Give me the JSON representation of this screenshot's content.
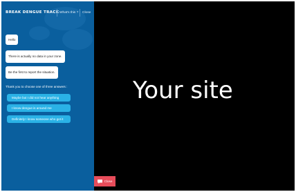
{
  "header": {
    "brand": "BREAK DENGUE TRACK",
    "whats_this": "What's this ?",
    "close": "Close"
  },
  "chat": {
    "messages": [
      "Hello",
      "There is actually no data in your zone.",
      "Be the first to report the situation."
    ],
    "prompt": "Thank you to choose one of three answers :",
    "answers": [
      "Maybe but I did not hear anything",
      "I know dengue is around me",
      "Definitely I know someone who got it"
    ]
  },
  "site": {
    "text": "Your site"
  },
  "toggle": {
    "label": "Close",
    "icon": "chat-icon"
  },
  "colors": {
    "panel": "#0a5f9e",
    "answer_button": "#2ab2e6",
    "close_tab": "#e74c5a",
    "site_background": "#000000"
  }
}
